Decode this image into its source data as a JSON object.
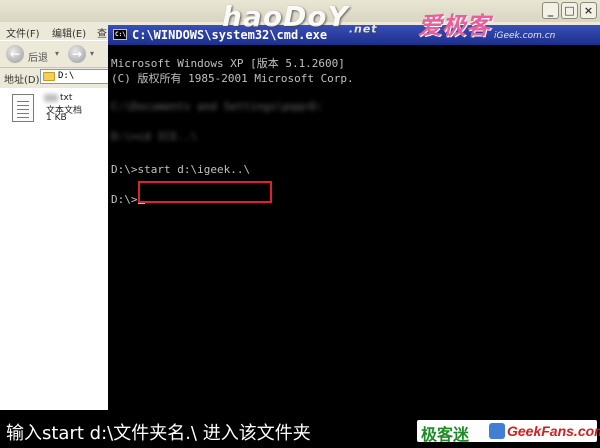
{
  "explorer": {
    "window_controls": [
      "_",
      "□",
      "×"
    ],
    "menu": [
      "文件(F)",
      "编辑(E)",
      "查"
    ],
    "toolbar": {
      "back_label": "后退",
      "back_arrow": "←",
      "forward_arrow": "→",
      "caret": "▾"
    },
    "address_label": "地址(D)",
    "address_value": "D:\\",
    "file": {
      "name": "txt",
      "type": "文本文档",
      "size": "1 KB"
    }
  },
  "cmd": {
    "title": "C:\\WINDOWS\\system32\\cmd.exe",
    "icon_text": "C:\\",
    "lines": {
      "version": "Microsoft Windows XP [版本 5.1.2600]",
      "copyright": "(C) 版权所有 1985-2001 Microsoft Corp.",
      "blurred_1": "C:\\Documents and Settings\\pqq>D:",
      "blurred_2": "D:\\>cd ICE..\\",
      "prompt_1": "D:\\>",
      "command": "start d:\\igeek..\\",
      "prompt_2": "D:\\>"
    }
  },
  "watermark": {
    "text": "haoDoY",
    "suffix": ".net"
  },
  "brand": {
    "name": "爱极客",
    "url": "iGeek.com.cn"
  },
  "caption": {
    "text": "输入start d:\\文件夹名.\\ 进入该文件夹"
  },
  "logo": {
    "cn": "极客迷",
    "en": "GeekFans.com"
  },
  "colors": {
    "highlight": "#e0202a",
    "console_bg": "#000000",
    "titlebar": "#0a246a"
  }
}
